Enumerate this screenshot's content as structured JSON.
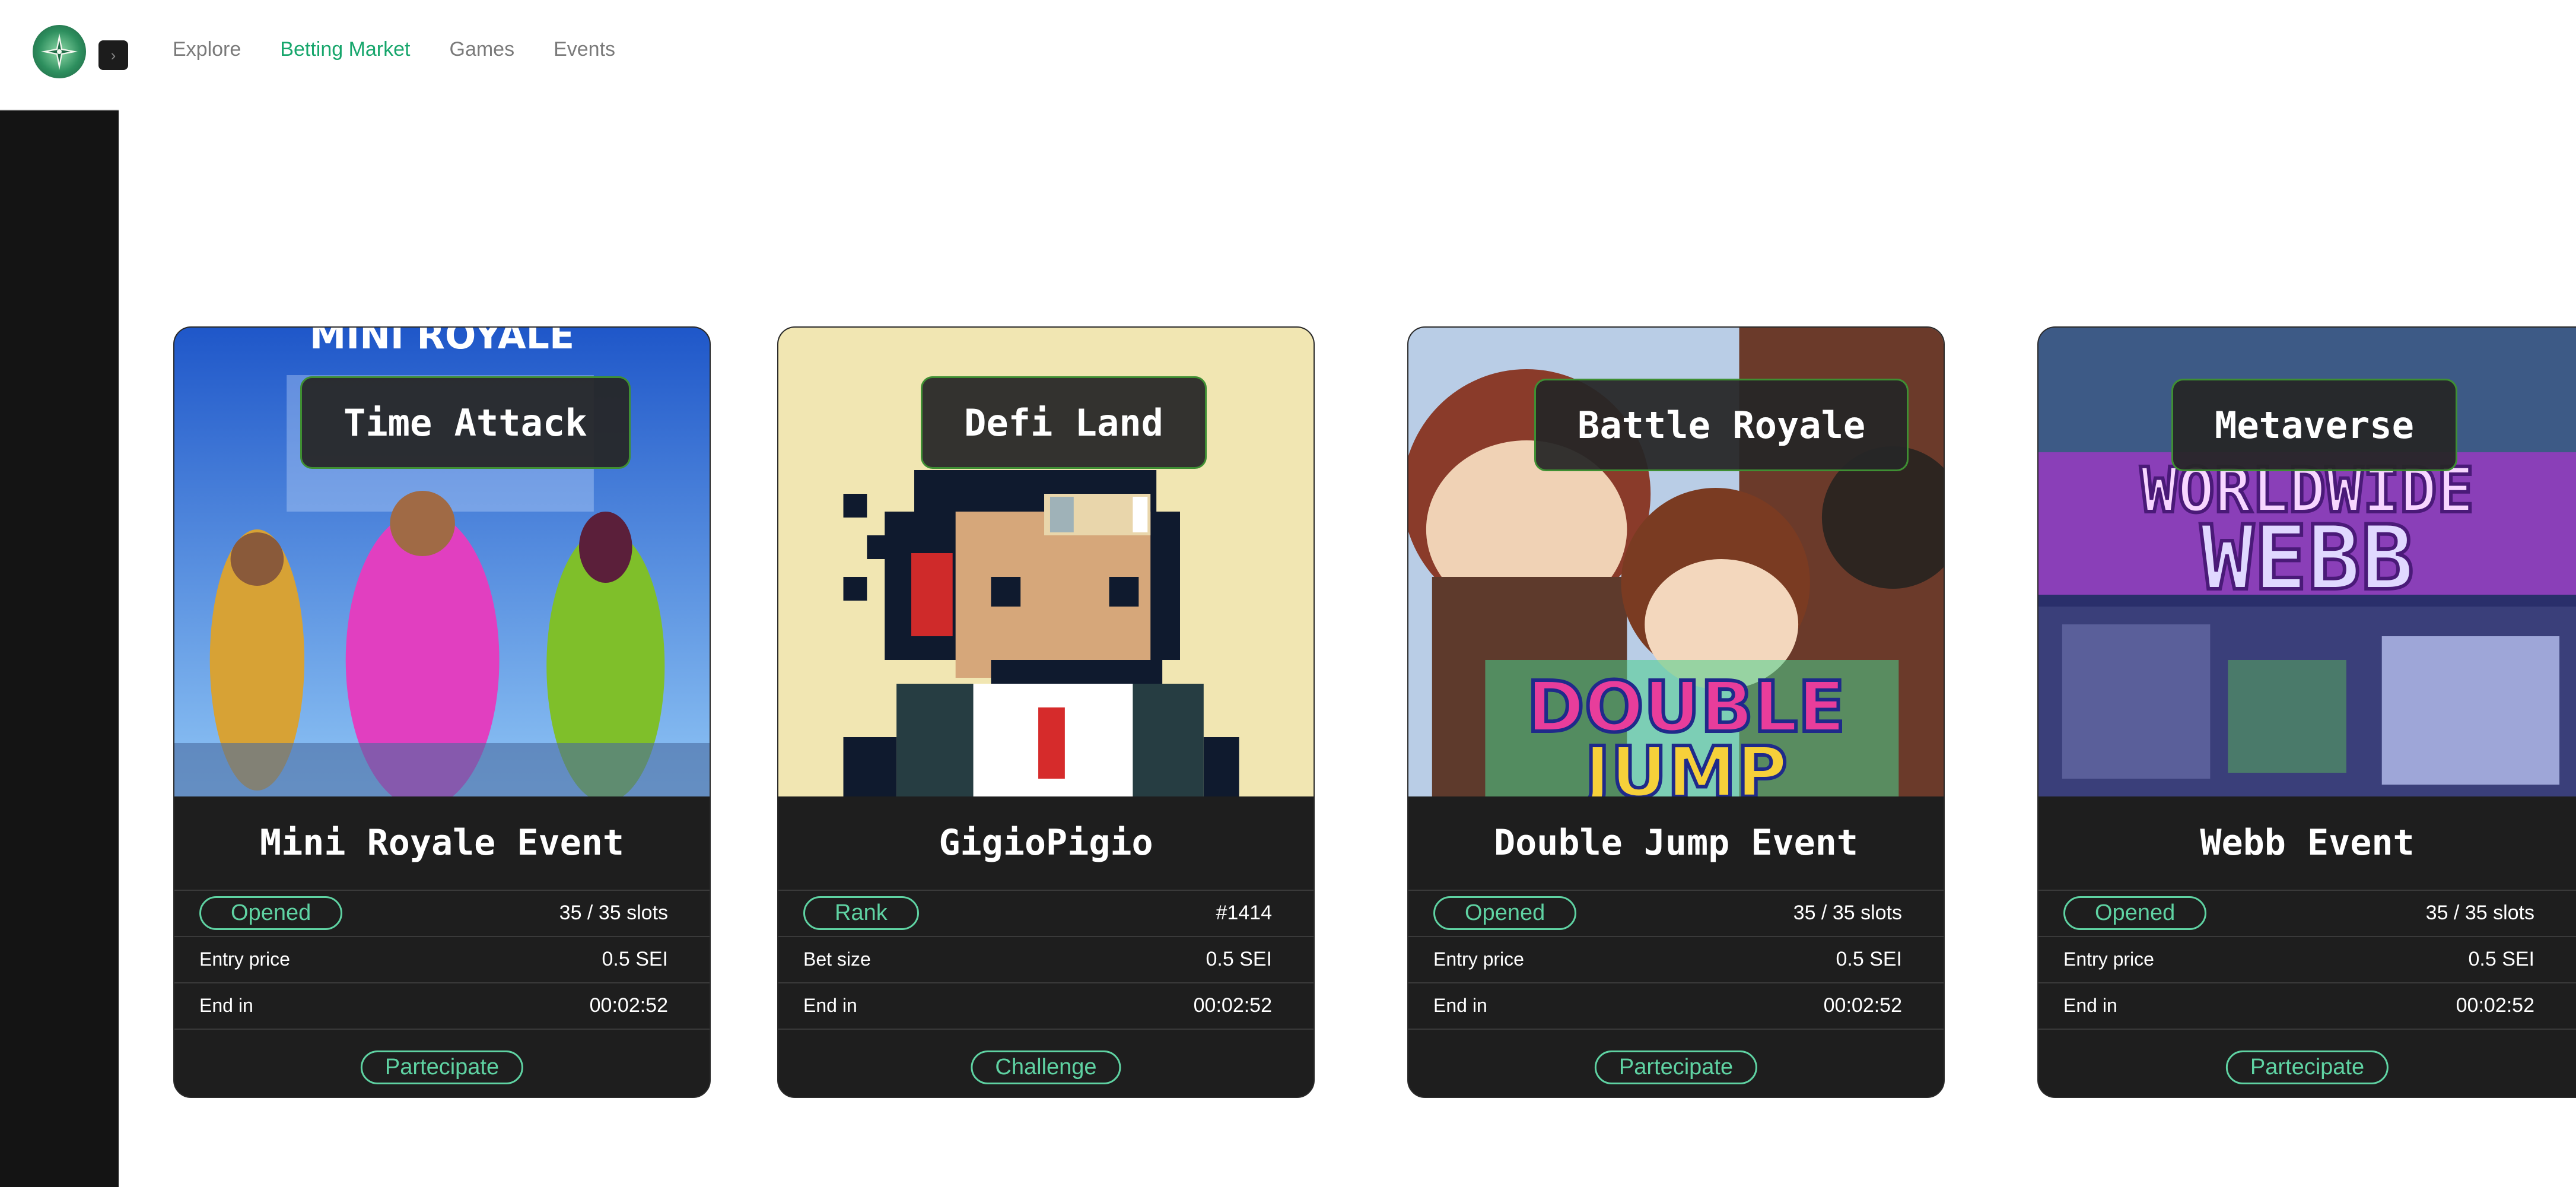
{
  "nav": {
    "items": [
      {
        "label": "Explore",
        "active": false
      },
      {
        "label": "Betting Market",
        "active": true
      },
      {
        "label": "Games",
        "active": false
      },
      {
        "label": "Events",
        "active": false
      }
    ]
  },
  "sidebar": {
    "toggle_icon": "chevron-right-icon",
    "logo_icon": "compass-star-icon"
  },
  "colors": {
    "accent": "#17a66c",
    "pill": "#5fd3a3",
    "card": "#1e1e1e",
    "sidebar": "#141414"
  },
  "cards": [
    {
      "game": "Time Attack",
      "title": "Mini Royale Event",
      "status": "Opened",
      "status_value": "35 / 35 slots",
      "row2_label": "Entry price",
      "row2_value": "0.5 SEI",
      "row3_label": "End in",
      "row3_value": "00:02:52",
      "action": "Partecipate",
      "image_text": "MINI ROYALE"
    },
    {
      "game": "Defi Land",
      "title": "GigioPigio",
      "status": "Rank",
      "status_value": "#1414",
      "row2_label": "Bet size",
      "row2_value": "0.5 SEI",
      "row3_label": "End in",
      "row3_value": "00:02:52",
      "action": "Challenge"
    },
    {
      "game": "Battle Royale",
      "title": "Double Jump Event",
      "status": "Opened",
      "status_value": "35 / 35 slots",
      "row2_label": "Entry price",
      "row2_value": "0.5 SEI",
      "row3_label": "End in",
      "row3_value": "00:02:52",
      "action": "Partecipate",
      "image_text_1": "DOUBLE",
      "image_text_2": "JUMP"
    },
    {
      "game": "Metaverse",
      "title": "Webb Event",
      "status": "Opened",
      "status_value": "35 / 35 slots",
      "row2_label": "Entry price",
      "row2_value": "0.5 SEI",
      "row3_label": "End in",
      "row3_value": "00:02:52",
      "action": "Partecipate",
      "image_text_1": "WORLDWIDE",
      "image_text_2": "WEBB"
    }
  ]
}
